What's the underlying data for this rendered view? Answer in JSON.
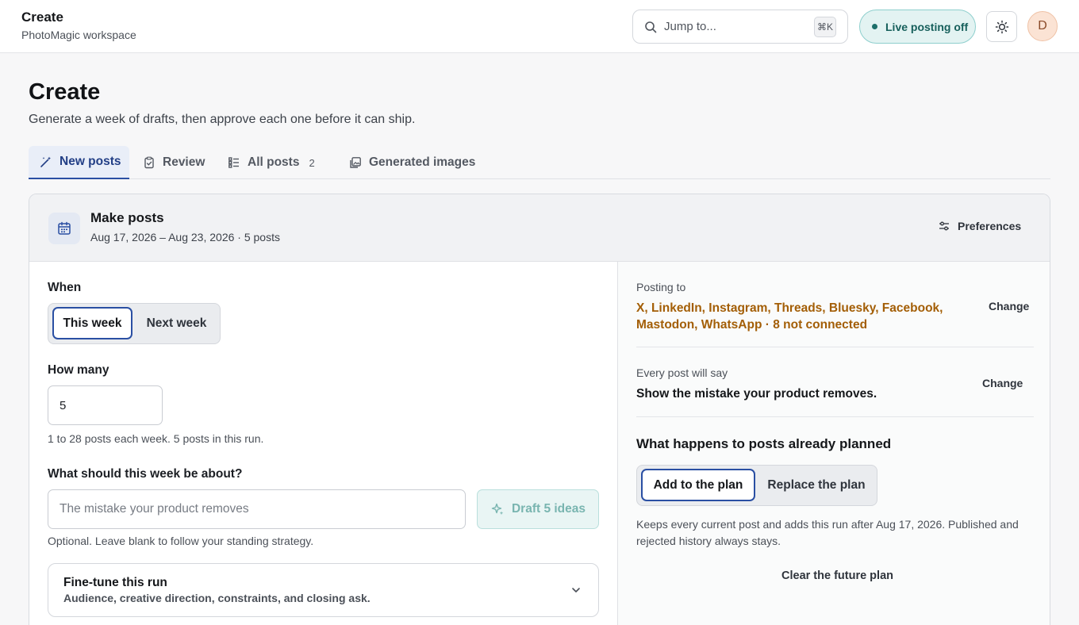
{
  "topbar": {
    "title": "Create",
    "workspace": "PhotoMagic workspace",
    "search_placeholder": "Jump to...",
    "search_shortcut": "⌘K",
    "live_label": "Live posting off",
    "avatar_initial": "D"
  },
  "page": {
    "title": "Create",
    "subtitle": "Generate a week of drafts, then approve each one before it can ship."
  },
  "tabs": [
    {
      "label": "New posts",
      "active": true
    },
    {
      "label": "Review"
    },
    {
      "label": "All posts",
      "count": "2"
    },
    {
      "label": "Generated images"
    }
  ],
  "card": {
    "title": "Make posts",
    "subtitle": "Aug 17, 2026 – Aug 23, 2026 · 5 posts",
    "preferences_label": "Preferences"
  },
  "form": {
    "when_label": "When",
    "when_options": [
      "This week",
      "Next week"
    ],
    "when_selected": "This week",
    "how_many_label": "How many",
    "how_many_value": "5",
    "how_many_hint": "1 to 28 posts each week. 5 posts in this run.",
    "topic_label": "What should this week be about?",
    "topic_placeholder": "The mistake your product removes",
    "draft_button": "Draft 5 ideas",
    "topic_hint": "Optional. Leave blank to follow your standing strategy.",
    "fine_tune_title": "Fine-tune this run",
    "fine_tune_subtitle": "Audience, creative direction, constraints, and closing ask."
  },
  "side": {
    "posting_to_label": "Posting to",
    "posting_to_value": "X, LinkedIn, Instagram, Threads, Bluesky, Facebook, Mastodon, WhatsApp · 8 not connected",
    "change_label_1": "Change",
    "every_post_label": "Every post will say",
    "every_post_value": "Show the mistake your product removes.",
    "change_label_2": "Change",
    "planned_heading": "What happens to posts already planned",
    "planned_options": [
      "Add to the plan",
      "Replace the plan"
    ],
    "planned_selected": "Add to the plan",
    "planned_note": "Keeps every current post and adds this run after Aug 17, 2026. Published and rejected history always stays.",
    "clear_button": "Clear the future plan"
  },
  "colors": {
    "accent": "#2a4fa3",
    "warning_text": "#a35e06",
    "live_teal": "#17605c"
  }
}
